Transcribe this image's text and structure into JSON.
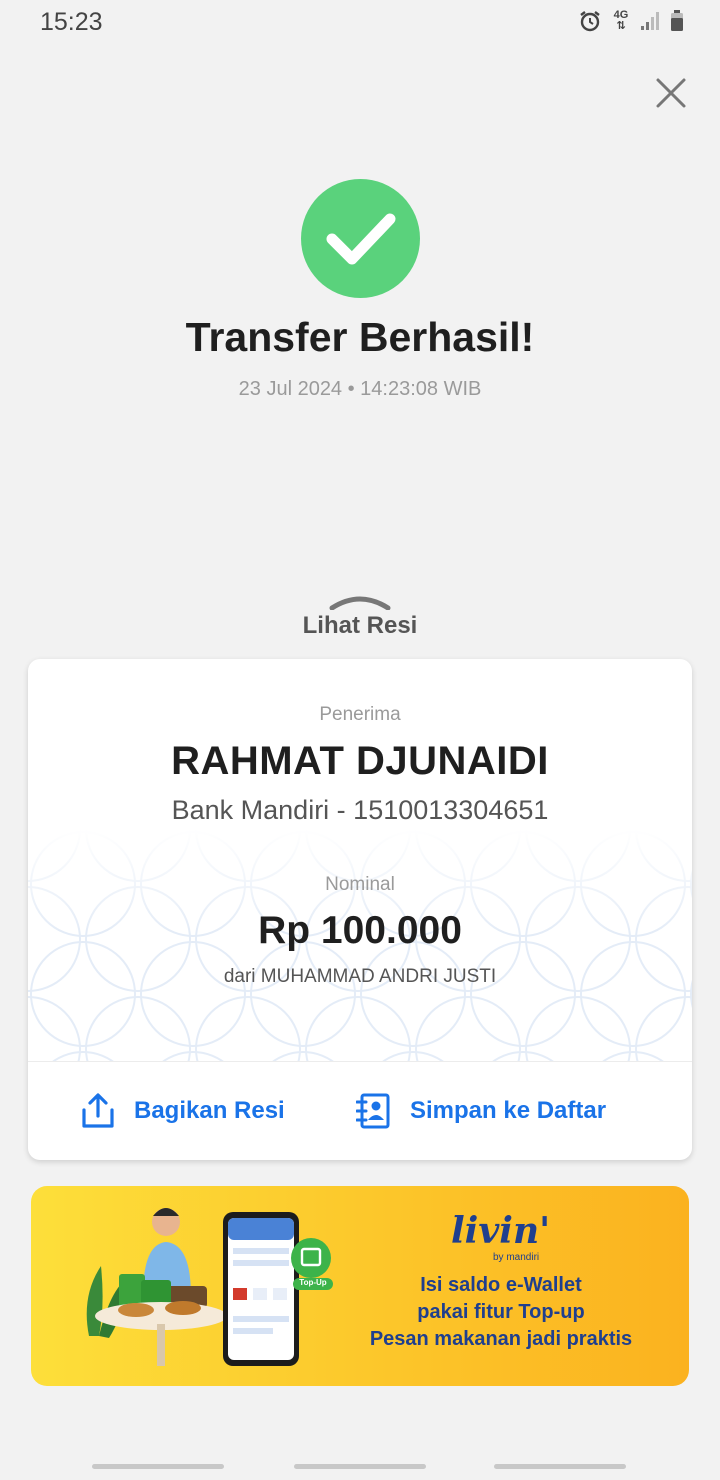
{
  "status_bar": {
    "time": "15:23",
    "network": "4G",
    "icons": [
      "alarm-icon",
      "network-4g-icon",
      "signal-icon",
      "battery-icon"
    ]
  },
  "header": {
    "close_icon": "close-icon"
  },
  "result": {
    "icon": "check-icon",
    "title": "Transfer Berhasil!",
    "datetime": "23 Jul 2024 • 14:23:08 WIB",
    "success_color": "#5ad27c"
  },
  "lihat_resi": {
    "label": "Lihat Resi",
    "icon": "chevron-up-icon"
  },
  "receipt": {
    "recipient_label": "Penerima",
    "recipient_name": "RAHMAT DJUNAIDI",
    "recipient_bank": "Bank Mandiri - 1510013304651",
    "nominal_label": "Nominal",
    "amount": "Rp 100.000",
    "sender": "dari MUHAMMAD ANDRI JUSTI"
  },
  "actions": {
    "share_label": "Bagikan Resi",
    "share_icon": "share-icon",
    "save_label": "Simpan ke Daftar",
    "save_icon": "save-contact-icon",
    "accent_color": "#1a73e8"
  },
  "promo": {
    "logo": "livin'",
    "logo_sub": "by mandiri",
    "line1": "Isi saldo e-Wallet",
    "line2": "pakai fitur Top-up",
    "line3": "Pesan makanan jadi praktis",
    "phone_badge": "Top-Up",
    "brand_color": "#1f3f8e"
  }
}
